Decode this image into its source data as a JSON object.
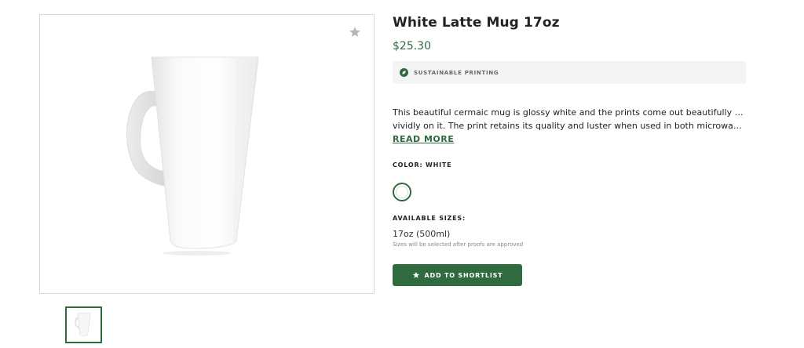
{
  "product": {
    "title": "White Latte Mug 17oz",
    "price": "$25.30",
    "badge": "SUSTAINABLE PRINTING",
    "description_line1": "This beautiful cermaic mug is glossy white and the prints come out beautifully and",
    "description_line2": "vividly on it. The print retains its quality and luster when used in both microwaves a...",
    "read_more": "READ MORE",
    "color_label": "COLOR: WHITE",
    "sizes_label": "AVAILABLE SIZES:",
    "size_value": "17oz (500ml)",
    "size_note": "Sizes will be selected after proofs are approved",
    "shortlist_button": "ADD TO SHORTLIST"
  },
  "icons": {
    "favorite": "star-icon",
    "badge": "leaf-icon",
    "button": "star-icon"
  },
  "colors": {
    "accent": "#2f6b3e",
    "badge_bg": "#f4f4f4",
    "swatch": "#ffffff"
  }
}
